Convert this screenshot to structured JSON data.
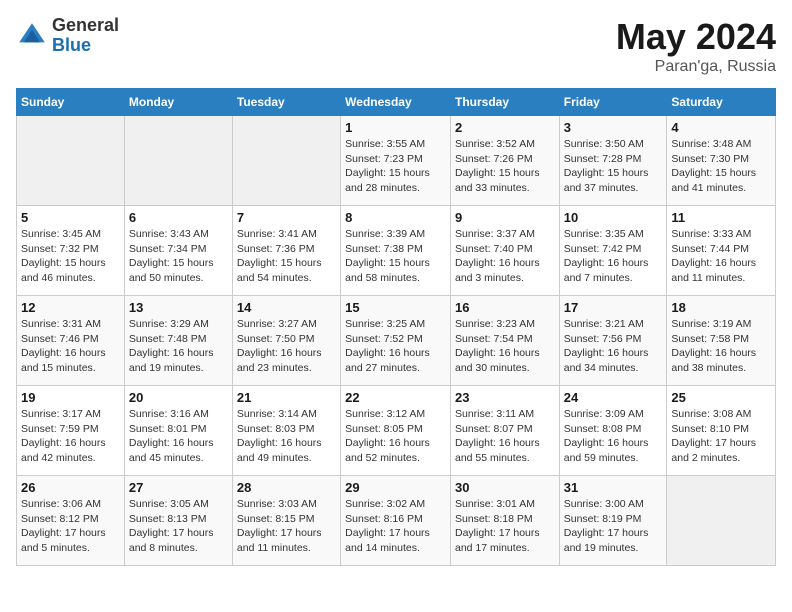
{
  "header": {
    "logo_general": "General",
    "logo_blue": "Blue",
    "title": "May 2024",
    "location": "Paran'ga, Russia"
  },
  "days_of_week": [
    "Sunday",
    "Monday",
    "Tuesday",
    "Wednesday",
    "Thursday",
    "Friday",
    "Saturday"
  ],
  "weeks": [
    [
      {
        "day": "",
        "info": ""
      },
      {
        "day": "",
        "info": ""
      },
      {
        "day": "",
        "info": ""
      },
      {
        "day": "1",
        "info": "Sunrise: 3:55 AM\nSunset: 7:23 PM\nDaylight: 15 hours\nand 28 minutes."
      },
      {
        "day": "2",
        "info": "Sunrise: 3:52 AM\nSunset: 7:26 PM\nDaylight: 15 hours\nand 33 minutes."
      },
      {
        "day": "3",
        "info": "Sunrise: 3:50 AM\nSunset: 7:28 PM\nDaylight: 15 hours\nand 37 minutes."
      },
      {
        "day": "4",
        "info": "Sunrise: 3:48 AM\nSunset: 7:30 PM\nDaylight: 15 hours\nand 41 minutes."
      }
    ],
    [
      {
        "day": "5",
        "info": "Sunrise: 3:45 AM\nSunset: 7:32 PM\nDaylight: 15 hours\nand 46 minutes."
      },
      {
        "day": "6",
        "info": "Sunrise: 3:43 AM\nSunset: 7:34 PM\nDaylight: 15 hours\nand 50 minutes."
      },
      {
        "day": "7",
        "info": "Sunrise: 3:41 AM\nSunset: 7:36 PM\nDaylight: 15 hours\nand 54 minutes."
      },
      {
        "day": "8",
        "info": "Sunrise: 3:39 AM\nSunset: 7:38 PM\nDaylight: 15 hours\nand 58 minutes."
      },
      {
        "day": "9",
        "info": "Sunrise: 3:37 AM\nSunset: 7:40 PM\nDaylight: 16 hours\nand 3 minutes."
      },
      {
        "day": "10",
        "info": "Sunrise: 3:35 AM\nSunset: 7:42 PM\nDaylight: 16 hours\nand 7 minutes."
      },
      {
        "day": "11",
        "info": "Sunrise: 3:33 AM\nSunset: 7:44 PM\nDaylight: 16 hours\nand 11 minutes."
      }
    ],
    [
      {
        "day": "12",
        "info": "Sunrise: 3:31 AM\nSunset: 7:46 PM\nDaylight: 16 hours\nand 15 minutes."
      },
      {
        "day": "13",
        "info": "Sunrise: 3:29 AM\nSunset: 7:48 PM\nDaylight: 16 hours\nand 19 minutes."
      },
      {
        "day": "14",
        "info": "Sunrise: 3:27 AM\nSunset: 7:50 PM\nDaylight: 16 hours\nand 23 minutes."
      },
      {
        "day": "15",
        "info": "Sunrise: 3:25 AM\nSunset: 7:52 PM\nDaylight: 16 hours\nand 27 minutes."
      },
      {
        "day": "16",
        "info": "Sunrise: 3:23 AM\nSunset: 7:54 PM\nDaylight: 16 hours\nand 30 minutes."
      },
      {
        "day": "17",
        "info": "Sunrise: 3:21 AM\nSunset: 7:56 PM\nDaylight: 16 hours\nand 34 minutes."
      },
      {
        "day": "18",
        "info": "Sunrise: 3:19 AM\nSunset: 7:58 PM\nDaylight: 16 hours\nand 38 minutes."
      }
    ],
    [
      {
        "day": "19",
        "info": "Sunrise: 3:17 AM\nSunset: 7:59 PM\nDaylight: 16 hours\nand 42 minutes."
      },
      {
        "day": "20",
        "info": "Sunrise: 3:16 AM\nSunset: 8:01 PM\nDaylight: 16 hours\nand 45 minutes."
      },
      {
        "day": "21",
        "info": "Sunrise: 3:14 AM\nSunset: 8:03 PM\nDaylight: 16 hours\nand 49 minutes."
      },
      {
        "day": "22",
        "info": "Sunrise: 3:12 AM\nSunset: 8:05 PM\nDaylight: 16 hours\nand 52 minutes."
      },
      {
        "day": "23",
        "info": "Sunrise: 3:11 AM\nSunset: 8:07 PM\nDaylight: 16 hours\nand 55 minutes."
      },
      {
        "day": "24",
        "info": "Sunrise: 3:09 AM\nSunset: 8:08 PM\nDaylight: 16 hours\nand 59 minutes."
      },
      {
        "day": "25",
        "info": "Sunrise: 3:08 AM\nSunset: 8:10 PM\nDaylight: 17 hours\nand 2 minutes."
      }
    ],
    [
      {
        "day": "26",
        "info": "Sunrise: 3:06 AM\nSunset: 8:12 PM\nDaylight: 17 hours\nand 5 minutes."
      },
      {
        "day": "27",
        "info": "Sunrise: 3:05 AM\nSunset: 8:13 PM\nDaylight: 17 hours\nand 8 minutes."
      },
      {
        "day": "28",
        "info": "Sunrise: 3:03 AM\nSunset: 8:15 PM\nDaylight: 17 hours\nand 11 minutes."
      },
      {
        "day": "29",
        "info": "Sunrise: 3:02 AM\nSunset: 8:16 PM\nDaylight: 17 hours\nand 14 minutes."
      },
      {
        "day": "30",
        "info": "Sunrise: 3:01 AM\nSunset: 8:18 PM\nDaylight: 17 hours\nand 17 minutes."
      },
      {
        "day": "31",
        "info": "Sunrise: 3:00 AM\nSunset: 8:19 PM\nDaylight: 17 hours\nand 19 minutes."
      },
      {
        "day": "",
        "info": ""
      }
    ]
  ]
}
